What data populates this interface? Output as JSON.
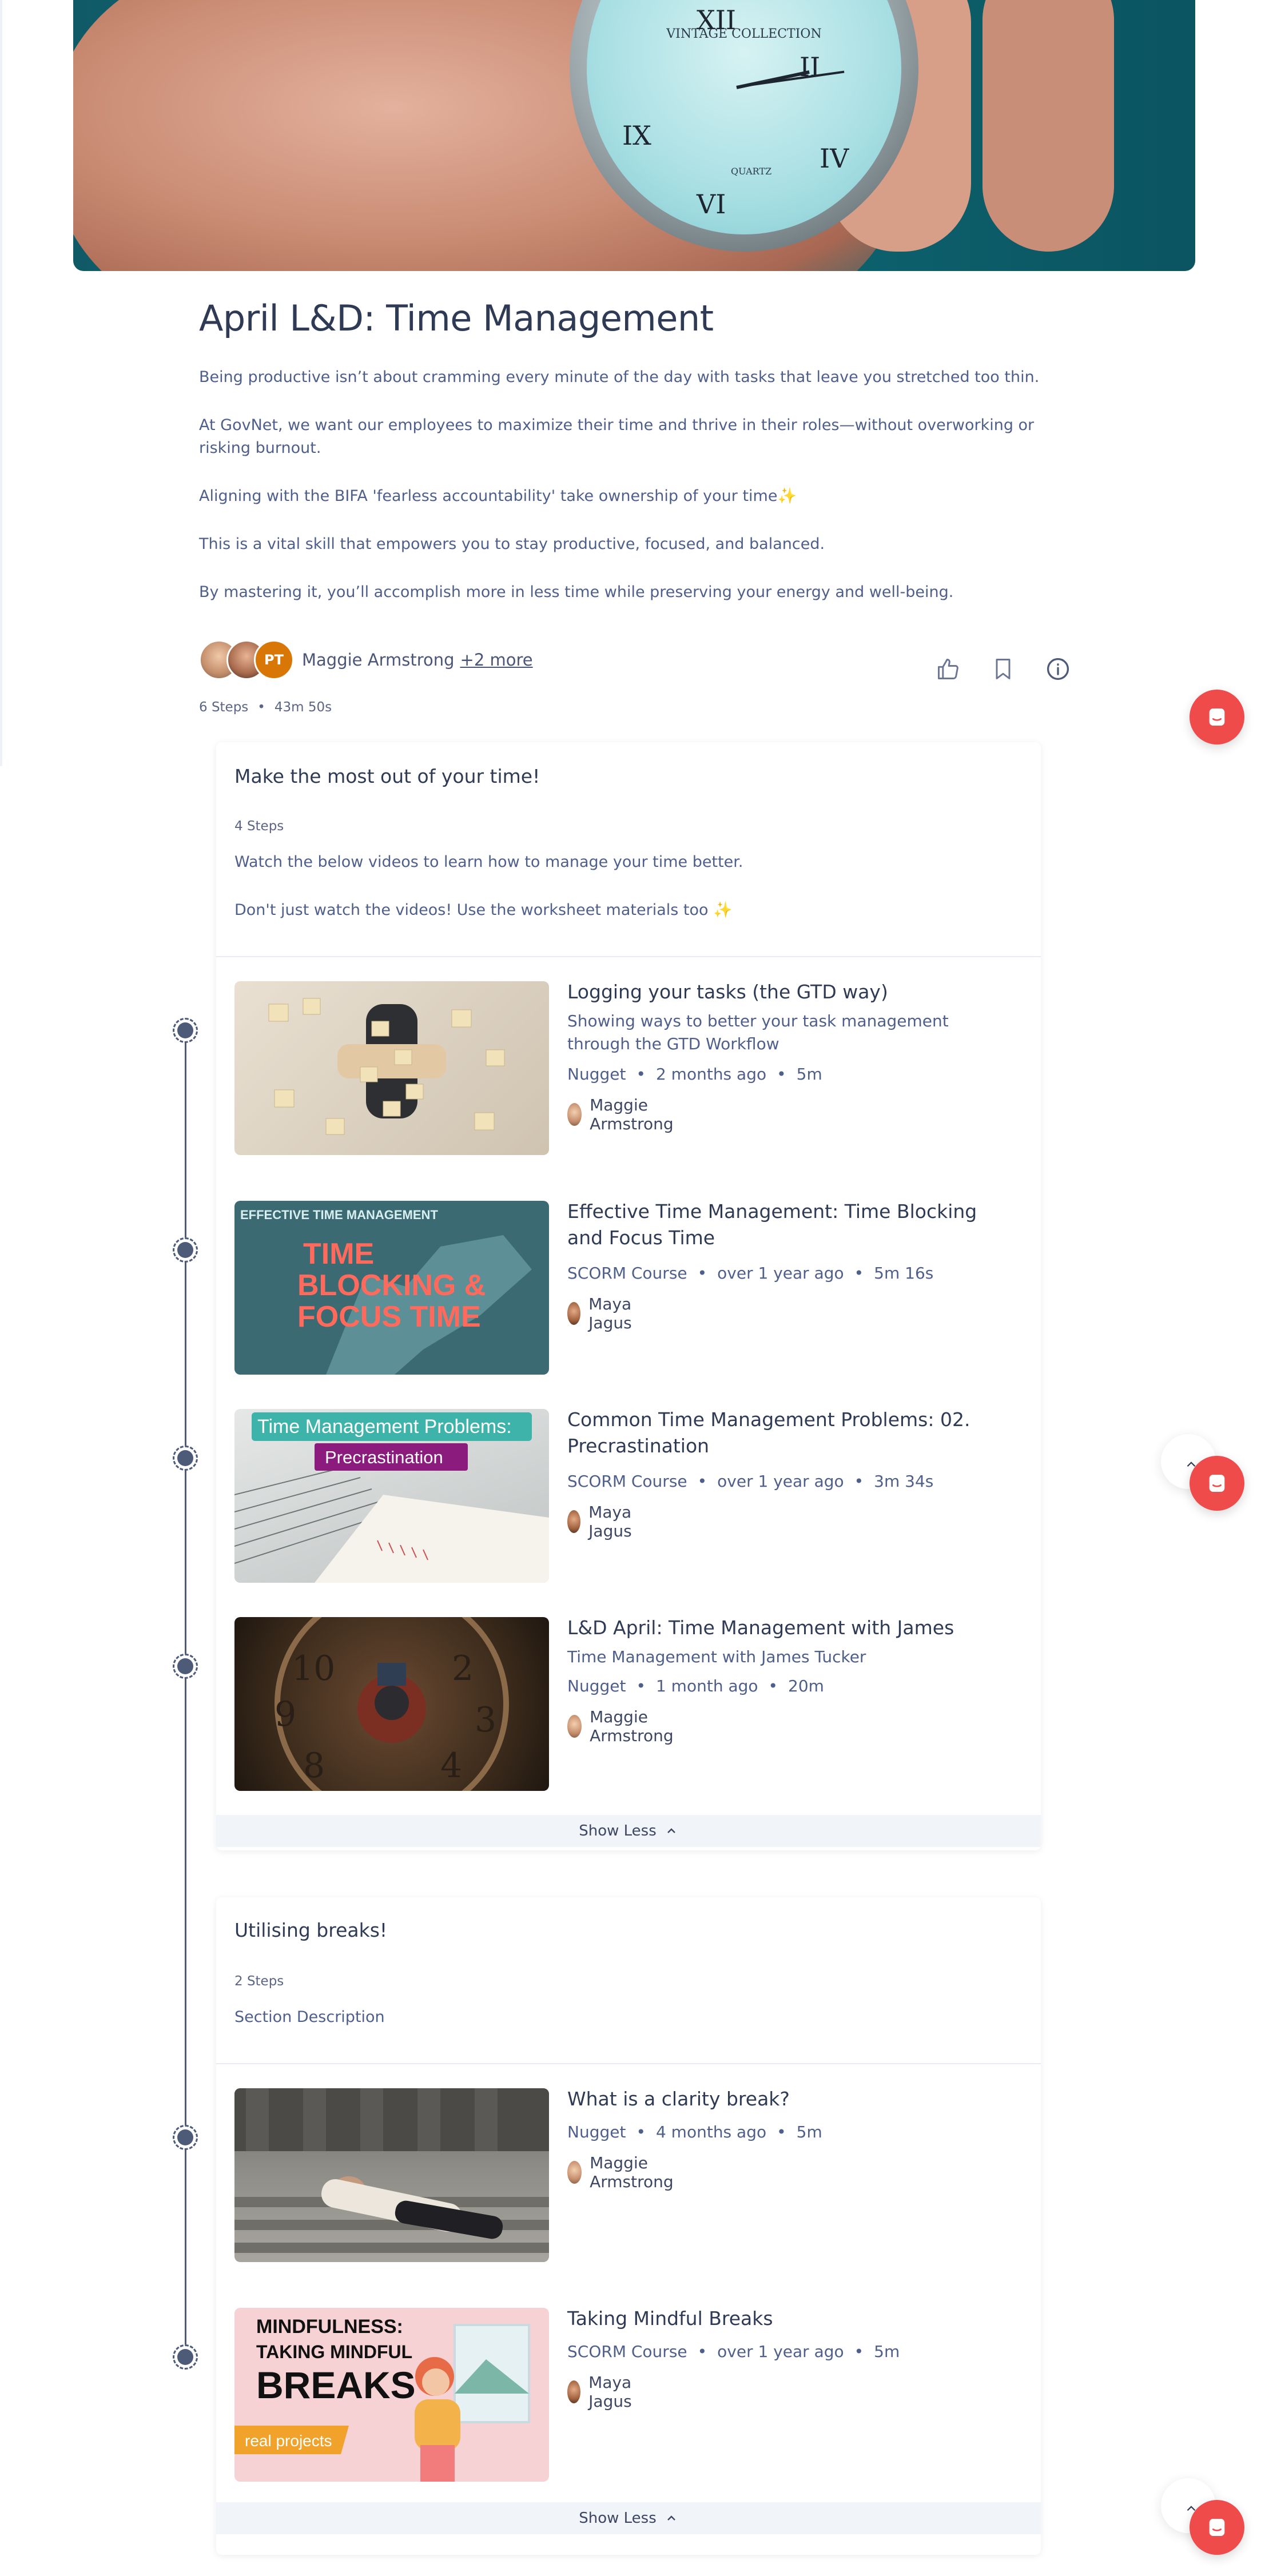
{
  "hero": {
    "alt": "Hand holding a vintage pocket watch",
    "watch_brand": "VINTAGE COLLECTION",
    "watch_movement": "QUARTZ"
  },
  "course": {
    "title": "April L&D: Time Management",
    "description": [
      "Being productive isn’t about cramming every minute of the day with tasks that leave you stretched too thin.",
      "At GovNet, we want our employees to maximize their time and thrive in their roles—without overworking or risking burnout.",
      "Aligning with the BIFA 'fearless accountability' take ownership of your time✨",
      "This is a vital skill that empowers you to stay productive, focused, and balanced.",
      "By mastering it, you’ll accomplish more in less time while preserving your energy and well-being."
    ],
    "authors": {
      "initials": "PT",
      "primary": "Maggie Armstrong",
      "more": "+2 more"
    },
    "steps": "6 Steps",
    "duration": "43m 50s"
  },
  "sections": [
    {
      "title": "Make the most out of your time!",
      "steps": "4 Steps",
      "description": [
        "Watch the below videos to learn how to manage your time better.",
        "Don't just watch the videos! Use the worksheet materials too ✨"
      ],
      "show_less": "Show Less",
      "items": [
        {
          "title": "Logging your tasks (the GTD way)",
          "subtitle": "Showing ways to better your task management through the GTD Workflow",
          "type": "Nugget",
          "age": "2 months ago",
          "duration": "5m",
          "author": "Maggie Armstrong"
        },
        {
          "title": "Effective Time Management: Time Blocking and Focus Time",
          "type": "SCORM Course",
          "age": "over 1 year ago",
          "duration": "5m 16s",
          "author": "Maya Jagus",
          "thumb_kicker": "EFFECTIVE TIME MANAGEMENT",
          "thumb_headline": "TIME BLOCKING & FOCUS TIME"
        },
        {
          "title": "Common Time Management Problems: 02. Precrastination",
          "type": "SCORM Course",
          "age": "over 1 year ago",
          "duration": "3m 34s",
          "author": "Maya Jagus",
          "thumb_line1": "Time Management Problems:",
          "thumb_line2": "Precrastination"
        },
        {
          "title": "L&D April: Time Management with James",
          "subtitle": "Time Management with James Tucker",
          "type": "Nugget",
          "age": "1 month ago",
          "duration": "20m",
          "author": "Maggie Armstrong"
        }
      ]
    },
    {
      "title": "Utilising breaks!",
      "steps": "2 Steps",
      "description": [
        "Section Description"
      ],
      "show_less": "Show Less",
      "items": [
        {
          "title": "What is a clarity break?",
          "type": "Nugget",
          "age": "4 months ago",
          "duration": "5m",
          "author": "Maggie Armstrong"
        },
        {
          "title": "Taking Mindful Breaks",
          "type": "SCORM Course",
          "age": "over 1 year ago",
          "duration": "5m",
          "author": "Maya Jagus",
          "thumb_line1": "MINDFULNESS:",
          "thumb_line2": "TAKING MINDFUL",
          "thumb_line3": "BREAKS",
          "thumb_brand": "real projects"
        }
      ]
    }
  ],
  "colors": {
    "accent_fab": "#ef4b4b",
    "text_title": "#2f3a55",
    "text_body": "#4f5f8c",
    "timeline": "#4d5a78",
    "avatar_pt": "#d97706"
  }
}
